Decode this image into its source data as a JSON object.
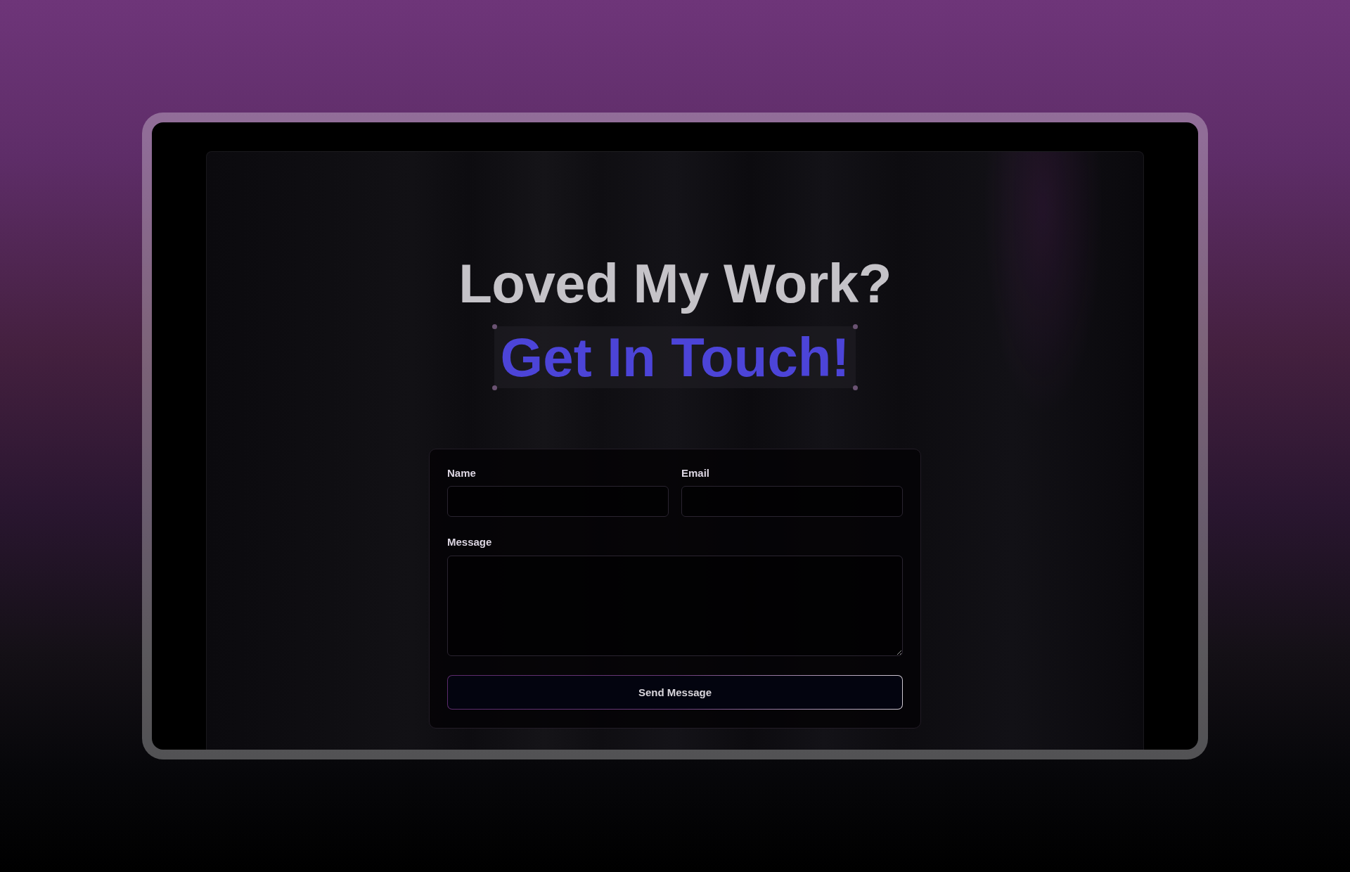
{
  "heading": {
    "line_1": "Loved My Work?",
    "line_2": "Get In Touch!"
  },
  "form": {
    "fields": [
      {
        "label": "Name",
        "kind": "input"
      },
      {
        "label": "Email",
        "kind": "input"
      },
      {
        "label": "Message",
        "kind": "textarea"
      }
    ],
    "submit_button": "Send Message"
  }
}
